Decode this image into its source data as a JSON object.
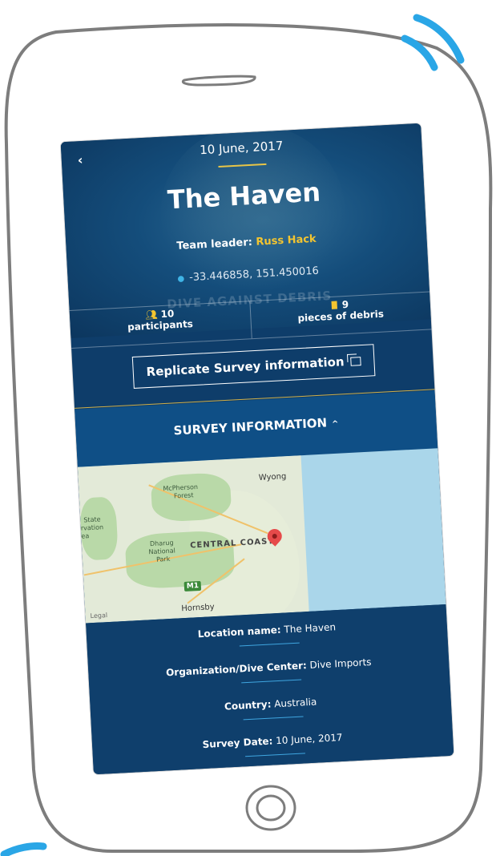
{
  "header": {
    "back_icon": "chevron-left-icon",
    "date": "10 June, 2017",
    "title": "The Haven",
    "team_leader_label": "Team leader:",
    "team_leader_name": "Russ Hack",
    "coordinates": "-33.446858, 151.450016",
    "watermark": "DIVE AGAINST DEBRIS"
  },
  "stats": {
    "participants_count": "10",
    "participants_label": "participants",
    "debris_count": "9",
    "debris_label": "pieces of debris"
  },
  "replicate_button": {
    "label": "Replicate Survey information"
  },
  "survey_section": {
    "title": "SURVEY INFORMATION",
    "toggle_icon": "chevron-up-icon"
  },
  "map": {
    "labels": {
      "wyong": "Wyong",
      "mcpherson": "McPherson",
      "forest": "Forest",
      "state": "State",
      "rvation": "rvation",
      "ea": "ea",
      "dharug": "Dharug",
      "national": "National",
      "park": "Park",
      "central_coast": "CENTRAL COAST",
      "m1": "M1",
      "legal": "Legal",
      "hornsby": "Hornsby"
    }
  },
  "details": [
    {
      "key": "Location name:",
      "value": "The Haven"
    },
    {
      "key": "Organization/Dive Center:",
      "value": "Dive Imports"
    },
    {
      "key": "Country:",
      "value": "Australia"
    },
    {
      "key": "Survey Date:",
      "value": "10 June, 2017"
    }
  ],
  "colors": {
    "accent_yellow": "#f4c530",
    "accent_blue": "#3fa6e0",
    "screen_bg": "#0e3d6a",
    "pin_red": "#e64a4a"
  }
}
